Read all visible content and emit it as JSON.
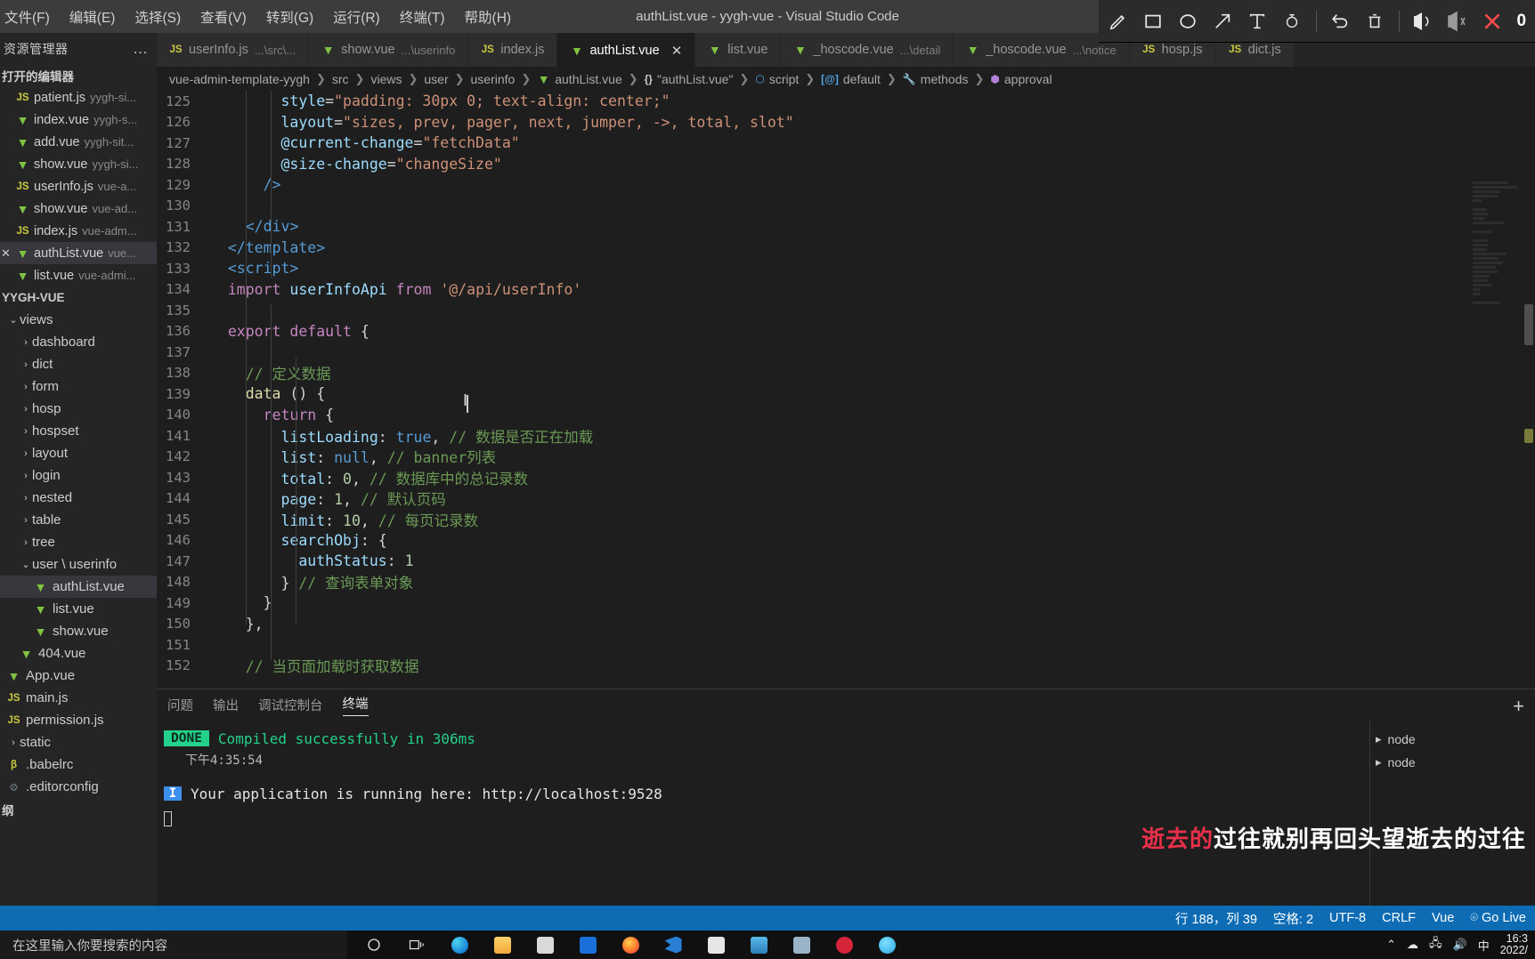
{
  "window": {
    "title": "authList.vue - yygh-vue - Visual Studio Code"
  },
  "menu": {
    "items": [
      "文件(F)",
      "编辑(E)",
      "选择(S)",
      "查看(V)",
      "转到(G)",
      "运行(R)",
      "终端(T)",
      "帮助(H)"
    ]
  },
  "screenshot_toolbar": {
    "tools": [
      "pen-icon",
      "rectangle-icon",
      "ellipse-icon",
      "arrow-icon",
      "text-icon",
      "mosaic-icon",
      "undo-icon",
      "delete-icon",
      "download-icon",
      "copy-icon",
      "close-icon"
    ],
    "count": "0"
  },
  "sidebar": {
    "title": "资源管理器",
    "more_label": "…",
    "open_editors_title": "打开的编辑器",
    "open_editors": [
      {
        "icon": "js-icon",
        "name": "patient.js",
        "dim": "yygh-si...",
        "active": false
      },
      {
        "icon": "vue-icon",
        "name": "index.vue",
        "dim": "yygh-s...",
        "active": false
      },
      {
        "icon": "vue-icon",
        "name": "add.vue",
        "dim": "yygh-sit...",
        "active": false
      },
      {
        "icon": "vue-icon",
        "name": "show.vue",
        "dim": "yygh-si...",
        "active": false
      },
      {
        "icon": "js-icon",
        "name": "userInfo.js",
        "dim": "vue-a...",
        "active": false
      },
      {
        "icon": "vue-icon",
        "name": "show.vue",
        "dim": "vue-ad...",
        "active": false
      },
      {
        "icon": "js-icon",
        "name": "index.js",
        "dim": "vue-adm...",
        "active": false
      },
      {
        "icon": "vue-icon",
        "name": "authList.vue",
        "dim": "vue...",
        "active": true
      },
      {
        "icon": "vue-icon",
        "name": "list.vue",
        "dim": "vue-admi...",
        "active": false
      }
    ],
    "project_title": "YYGH-VUE",
    "tree": [
      {
        "label": "views",
        "indent": 1,
        "chev": "▾",
        "icon": "",
        "active": false
      },
      {
        "label": "dashboard",
        "indent": 2,
        "chev": "›",
        "icon": "",
        "active": false
      },
      {
        "label": "dict",
        "indent": 2,
        "chev": "›",
        "icon": "",
        "active": false
      },
      {
        "label": "form",
        "indent": 2,
        "chev": "›",
        "icon": "",
        "active": false
      },
      {
        "label": "hosp",
        "indent": 2,
        "chev": "›",
        "icon": "",
        "active": false
      },
      {
        "label": "hospset",
        "indent": 2,
        "chev": "›",
        "icon": "",
        "active": false
      },
      {
        "label": "layout",
        "indent": 2,
        "chev": "›",
        "icon": "",
        "active": false
      },
      {
        "label": "login",
        "indent": 2,
        "chev": "›",
        "icon": "",
        "active": false
      },
      {
        "label": "nested",
        "indent": 2,
        "chev": "›",
        "icon": "",
        "active": false
      },
      {
        "label": "table",
        "indent": 2,
        "chev": "›",
        "icon": "",
        "active": false
      },
      {
        "label": "tree",
        "indent": 2,
        "chev": "›",
        "icon": "",
        "active": false
      },
      {
        "label": "user \\ userinfo",
        "indent": 2,
        "chev": "▾",
        "icon": "",
        "active": false
      },
      {
        "label": "authList.vue",
        "indent": 3,
        "chev": "",
        "icon": "vue-icon",
        "active": true
      },
      {
        "label": "list.vue",
        "indent": 3,
        "chev": "",
        "icon": "vue-icon",
        "active": false
      },
      {
        "label": "show.vue",
        "indent": 3,
        "chev": "",
        "icon": "vue-icon",
        "active": false
      },
      {
        "label": "404.vue",
        "indent": 2,
        "chev": "",
        "icon": "vue-icon",
        "active": false
      },
      {
        "label": "App.vue",
        "indent": 1,
        "chev": "",
        "icon": "vue-icon",
        "active": false
      },
      {
        "label": "main.js",
        "indent": 1,
        "chev": "",
        "icon": "js-icon",
        "active": false
      },
      {
        "label": "permission.js",
        "indent": 1,
        "chev": "",
        "icon": "js-icon",
        "active": false
      },
      {
        "label": "static",
        "indent": 1,
        "chev": "›",
        "icon": "",
        "active": false
      },
      {
        "label": ".babelrc",
        "indent": 1,
        "chev": "",
        "icon": "babel-icon",
        "active": false
      },
      {
        "label": ".editorconfig",
        "indent": 1,
        "chev": "",
        "icon": "cfg-icon",
        "active": false
      }
    ],
    "outline_title": "纲"
  },
  "tabs": [
    {
      "icon": "js-icon",
      "name": "userInfo.js",
      "dim": "...\\src\\...",
      "active": false,
      "closable": false
    },
    {
      "icon": "vue-icon",
      "name": "show.vue",
      "dim": "...\\userinfo",
      "active": false,
      "closable": false
    },
    {
      "icon": "js-icon",
      "name": "index.js",
      "dim": "",
      "active": false,
      "closable": false
    },
    {
      "icon": "vue-icon",
      "name": "authList.vue",
      "dim": "",
      "active": true,
      "closable": true
    },
    {
      "icon": "vue-icon",
      "name": "list.vue",
      "dim": "",
      "active": false,
      "closable": false
    },
    {
      "icon": "vue-icon",
      "name": "_hoscode.vue",
      "dim": "...\\detail",
      "active": false,
      "closable": false
    },
    {
      "icon": "vue-icon",
      "name": "_hoscode.vue",
      "dim": "...\\notice",
      "active": false,
      "closable": false
    },
    {
      "icon": "js-icon",
      "name": "hosp.js",
      "dim": "",
      "active": false,
      "closable": false
    },
    {
      "icon": "js-icon",
      "name": "dict.js",
      "dim": "",
      "active": false,
      "closable": false
    }
  ],
  "breadcrumbs": [
    {
      "label": "vue-admin-template-yygh",
      "icon": ""
    },
    {
      "label": "src",
      "icon": ""
    },
    {
      "label": "views",
      "icon": ""
    },
    {
      "label": "user",
      "icon": ""
    },
    {
      "label": "userinfo",
      "icon": ""
    },
    {
      "label": "authList.vue",
      "icon": "vue-icon"
    },
    {
      "label": "\"authList.vue\"",
      "icon": "braces-icon"
    },
    {
      "label": "script",
      "icon": "cube-blue-icon"
    },
    {
      "label": "default",
      "icon": "at-icon"
    },
    {
      "label": "methods",
      "icon": "wrench-icon"
    },
    {
      "label": "approval",
      "icon": "cube-purple-icon"
    }
  ],
  "editor": {
    "first_line": 125,
    "lines": [
      {
        "n": 125,
        "tokens": [
          {
            "t": "        ",
            "c": "t-punc"
          },
          {
            "t": "style",
            "c": "t-attr"
          },
          {
            "t": "=",
            "c": "t-punc"
          },
          {
            "t": "\"padding: 30px 0; text-align: center;\"",
            "c": "t-str"
          }
        ]
      },
      {
        "n": 126,
        "tokens": [
          {
            "t": "        ",
            "c": "t-punc"
          },
          {
            "t": "layout",
            "c": "t-attr"
          },
          {
            "t": "=",
            "c": "t-punc"
          },
          {
            "t": "\"sizes, prev, pager, next, jumper, ->, total, slot\"",
            "c": "t-str"
          }
        ]
      },
      {
        "n": 127,
        "tokens": [
          {
            "t": "        ",
            "c": "t-punc"
          },
          {
            "t": "@current-change",
            "c": "t-attr"
          },
          {
            "t": "=",
            "c": "t-punc"
          },
          {
            "t": "\"fetchData\"",
            "c": "t-str"
          }
        ]
      },
      {
        "n": 128,
        "tokens": [
          {
            "t": "        ",
            "c": "t-punc"
          },
          {
            "t": "@size-change",
            "c": "t-attr"
          },
          {
            "t": "=",
            "c": "t-punc"
          },
          {
            "t": "\"changeSize\"",
            "c": "t-str"
          }
        ]
      },
      {
        "n": 129,
        "tokens": [
          {
            "t": "      ",
            "c": "t-punc"
          },
          {
            "t": "/>",
            "c": "t-tag"
          }
        ]
      },
      {
        "n": 130,
        "tokens": []
      },
      {
        "n": 131,
        "tokens": [
          {
            "t": "    ",
            "c": "t-punc"
          },
          {
            "t": "</",
            "c": "t-tag"
          },
          {
            "t": "div",
            "c": "t-tag"
          },
          {
            "t": ">",
            "c": "t-tag"
          }
        ]
      },
      {
        "n": 132,
        "tokens": [
          {
            "t": "  ",
            "c": "t-punc"
          },
          {
            "t": "</",
            "c": "t-tag"
          },
          {
            "t": "template",
            "c": "t-tag"
          },
          {
            "t": ">",
            "c": "t-tag"
          }
        ]
      },
      {
        "n": 133,
        "tokens": [
          {
            "t": "  ",
            "c": "t-punc"
          },
          {
            "t": "<",
            "c": "t-tag"
          },
          {
            "t": "script",
            "c": "t-tag"
          },
          {
            "t": ">",
            "c": "t-tag"
          }
        ]
      },
      {
        "n": 134,
        "tokens": [
          {
            "t": "  ",
            "c": "t-punc"
          },
          {
            "t": "import",
            "c": "t-kw"
          },
          {
            "t": " ",
            "c": "t-punc"
          },
          {
            "t": "userInfoApi",
            "c": "t-var"
          },
          {
            "t": " ",
            "c": "t-punc"
          },
          {
            "t": "from",
            "c": "t-kw"
          },
          {
            "t": " ",
            "c": "t-punc"
          },
          {
            "t": "'@/api/userInfo'",
            "c": "t-str"
          }
        ]
      },
      {
        "n": 135,
        "tokens": []
      },
      {
        "n": 136,
        "tokens": [
          {
            "t": "  ",
            "c": "t-punc"
          },
          {
            "t": "export",
            "c": "t-kw"
          },
          {
            "t": " ",
            "c": "t-punc"
          },
          {
            "t": "default",
            "c": "t-kw"
          },
          {
            "t": " {",
            "c": "t-punc"
          }
        ]
      },
      {
        "n": 137,
        "tokens": []
      },
      {
        "n": 138,
        "tokens": [
          {
            "t": "    ",
            "c": "t-punc"
          },
          {
            "t": "// 定义数据",
            "c": "t-cmt"
          }
        ]
      },
      {
        "n": 139,
        "tokens": [
          {
            "t": "    ",
            "c": "t-punc"
          },
          {
            "t": "data",
            "c": "t-fn"
          },
          {
            "t": " () {",
            "c": "t-punc"
          }
        ]
      },
      {
        "n": 140,
        "tokens": [
          {
            "t": "      ",
            "c": "t-punc"
          },
          {
            "t": "return",
            "c": "t-kw"
          },
          {
            "t": " {",
            "c": "t-punc"
          }
        ]
      },
      {
        "n": 141,
        "tokens": [
          {
            "t": "        ",
            "c": "t-punc"
          },
          {
            "t": "listLoading",
            "c": "t-var"
          },
          {
            "t": ": ",
            "c": "t-punc"
          },
          {
            "t": "true",
            "c": "t-blue"
          },
          {
            "t": ", ",
            "c": "t-punc"
          },
          {
            "t": "// 数据是否正在加载",
            "c": "t-cmt"
          }
        ]
      },
      {
        "n": 142,
        "tokens": [
          {
            "t": "        ",
            "c": "t-punc"
          },
          {
            "t": "list",
            "c": "t-var"
          },
          {
            "t": ": ",
            "c": "t-punc"
          },
          {
            "t": "null",
            "c": "t-blue"
          },
          {
            "t": ", ",
            "c": "t-punc"
          },
          {
            "t": "// banner列表",
            "c": "t-cmt"
          }
        ]
      },
      {
        "n": 143,
        "tokens": [
          {
            "t": "        ",
            "c": "t-punc"
          },
          {
            "t": "total",
            "c": "t-var"
          },
          {
            "t": ": ",
            "c": "t-punc"
          },
          {
            "t": "0",
            "c": "t-num"
          },
          {
            "t": ", ",
            "c": "t-punc"
          },
          {
            "t": "// 数据库中的总记录数",
            "c": "t-cmt"
          }
        ]
      },
      {
        "n": 144,
        "tokens": [
          {
            "t": "        ",
            "c": "t-punc"
          },
          {
            "t": "page",
            "c": "t-var"
          },
          {
            "t": ": ",
            "c": "t-punc"
          },
          {
            "t": "1",
            "c": "t-num"
          },
          {
            "t": ", ",
            "c": "t-punc"
          },
          {
            "t": "// 默认页码",
            "c": "t-cmt"
          }
        ]
      },
      {
        "n": 145,
        "tokens": [
          {
            "t": "        ",
            "c": "t-punc"
          },
          {
            "t": "limit",
            "c": "t-var"
          },
          {
            "t": ": ",
            "c": "t-punc"
          },
          {
            "t": "10",
            "c": "t-num"
          },
          {
            "t": ", ",
            "c": "t-punc"
          },
          {
            "t": "// 每页记录数",
            "c": "t-cmt"
          }
        ]
      },
      {
        "n": 146,
        "tokens": [
          {
            "t": "        ",
            "c": "t-punc"
          },
          {
            "t": "searchObj",
            "c": "t-var"
          },
          {
            "t": ": {",
            "c": "t-punc"
          }
        ]
      },
      {
        "n": 147,
        "tokens": [
          {
            "t": "          ",
            "c": "t-punc"
          },
          {
            "t": "authStatus",
            "c": "t-var"
          },
          {
            "t": ": ",
            "c": "t-punc"
          },
          {
            "t": "1",
            "c": "t-num"
          }
        ]
      },
      {
        "n": 148,
        "tokens": [
          {
            "t": "        ",
            "c": "t-punc"
          },
          {
            "t": "} ",
            "c": "t-punc"
          },
          {
            "t": "// 查询表单对象",
            "c": "t-cmt"
          }
        ]
      },
      {
        "n": 149,
        "tokens": [
          {
            "t": "      ",
            "c": "t-punc"
          },
          {
            "t": "}",
            "c": "t-punc"
          }
        ]
      },
      {
        "n": 150,
        "tokens": [
          {
            "t": "    ",
            "c": "t-punc"
          },
          {
            "t": "},",
            "c": "t-punc"
          }
        ]
      },
      {
        "n": 151,
        "tokens": []
      },
      {
        "n": 152,
        "tokens": [
          {
            "t": "    ",
            "c": "t-punc"
          },
          {
            "t": "// 当页面加载时获取数据",
            "c": "t-cmt"
          }
        ]
      }
    ]
  },
  "panel": {
    "tabs": [
      {
        "label": "问题",
        "active": false
      },
      {
        "label": "输出",
        "active": false
      },
      {
        "label": "调试控制台",
        "active": false
      },
      {
        "label": "终端",
        "active": true
      }
    ],
    "add_label": "+",
    "terminal": {
      "done_badge": "DONE",
      "done_text": "Compiled successfully in 306ms",
      "timestamp": "下午4:35:54",
      "info_badge": "I",
      "info_text": "Your application is running here: http://localhost:9528",
      "cursor": "▋"
    },
    "terminal_list": [
      {
        "icon": "chevron-right-icon",
        "label": "node"
      },
      {
        "icon": "chevron-right-icon",
        "label": "node"
      }
    ]
  },
  "watermark": {
    "red": "逝去的",
    "white": "过往就别再回头望逝去的过往"
  },
  "statusbar": {
    "left": [],
    "right": [
      "行 188，列 39",
      "空格: 2",
      "UTF-8",
      "CRLF",
      "Vue",
      "Go Live"
    ]
  },
  "taskbar": {
    "search_placeholder": "在这里输入你要搜索的内容",
    "icons": [
      "cortana-icon",
      "task-view-icon",
      "edge-icon",
      "explorer-icon",
      "store-icon",
      "mail-icon",
      "firefox-icon",
      "vscode-icon",
      "copy-app-icon",
      "navicat-icon",
      "qq-icon",
      "netease-icon",
      "app-icon"
    ],
    "tray": [
      "chevron-up-icon",
      "cloud-icon",
      "network-icon",
      "volume-icon",
      "ime-中"
    ],
    "clock": {
      "time": "16:3",
      "date": "2022/"
    }
  }
}
